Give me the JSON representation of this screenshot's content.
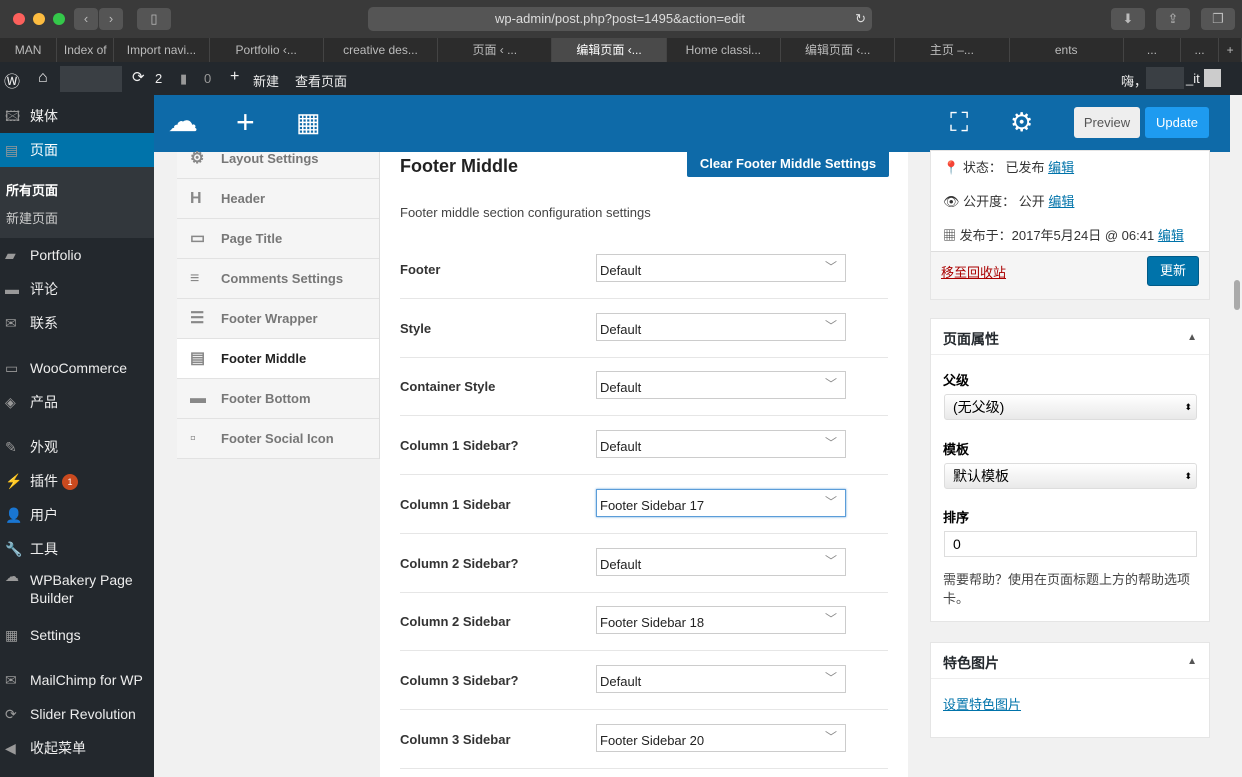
{
  "browser": {
    "url": "wp-admin/post.php?post=1495&action=edit",
    "tabs": [
      "MAN",
      "Index of",
      "Import navi...",
      "Portfolio ‹...",
      "creative des...",
      "页面 ‹ ...",
      "编辑页面 ‹...",
      "Home classi...",
      "编辑页面 ‹...",
      "主页 –...",
      "ents",
      "...",
      "...",
      "+"
    ],
    "active_tab": 6
  },
  "adminbar": {
    "updates": "2",
    "comments": "0",
    "new": "新建",
    "view": "查看页面",
    "greeting": "嗨，",
    "user_suffix": "_it"
  },
  "sidebar": {
    "items": [
      "媒体",
      "页面",
      "Portfolio",
      "评论",
      "联系",
      "WooCommerce",
      "产品",
      "外观",
      "插件",
      "用户",
      "工具",
      "WPBakery Page Builder",
      "Settings",
      "MailChimp for WP",
      "Slider Revolution",
      "收起菜单"
    ],
    "plugins_badge": "1",
    "submenu": [
      "所有页面",
      "新建页面"
    ]
  },
  "builder": {
    "preview": "Preview",
    "update": "Update",
    "nav": [
      "Layout Settings",
      "Header",
      "Page Title",
      "Comments Settings",
      "Footer Wrapper",
      "Footer Middle",
      "Footer Bottom",
      "Footer Social Icon"
    ],
    "active_nav": 5
  },
  "panel": {
    "title": "Footer Middle",
    "clear_button": "Clear Footer Middle Settings",
    "description": "Footer middle section configuration settings",
    "rows": [
      {
        "label": "Footer",
        "value": "Default"
      },
      {
        "label": "Style",
        "value": "Default"
      },
      {
        "label": "Container Style",
        "value": "Default"
      },
      {
        "label": "Column 1 Sidebar?",
        "value": "Default"
      },
      {
        "label": "Column 1 Sidebar",
        "value": "Footer Sidebar 17"
      },
      {
        "label": "Column 2 Sidebar?",
        "value": "Default"
      },
      {
        "label": "Column 2 Sidebar",
        "value": "Footer Sidebar 18"
      },
      {
        "label": "Column 3 Sidebar?",
        "value": "Default"
      },
      {
        "label": "Column 3 Sidebar",
        "value": "Footer Sidebar 20"
      }
    ]
  },
  "publish": {
    "status_label": "状态：",
    "status": "已发布",
    "visibility_label": "公开度：",
    "visibility": "公开",
    "date_label": "发布于：",
    "date": "2017年5月24日 @ 06:41",
    "edit": "编辑",
    "trash": "移至回收站",
    "update": "更新"
  },
  "attributes": {
    "title": "页面属性",
    "parent_label": "父级",
    "parent": "(无父级)",
    "template_label": "模板",
    "template": "默认模板",
    "order_label": "排序",
    "order": "0",
    "help": "需要帮助？使用在页面标题上方的帮助选项卡。"
  },
  "featured": {
    "title": "特色图片",
    "link": "设置特色图片"
  }
}
